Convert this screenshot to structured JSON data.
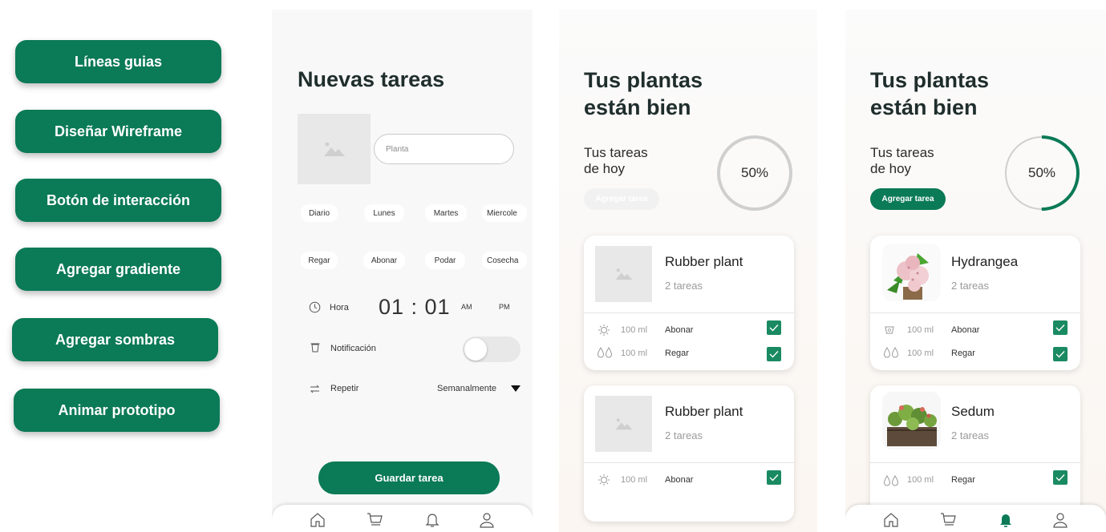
{
  "steps": [
    "Líneas guias",
    "Diseñar Wireframe",
    "Botón de interacción",
    "Agregar gradiente",
    "Agregar sombras",
    "Animar prototipo"
  ],
  "screen1": {
    "title": "Nuevas tareas",
    "plant_placeholder": "Planta",
    "days": [
      "Diario",
      "Lunes",
      "Martes",
      "Miercole"
    ],
    "tasks": [
      "Regar",
      "Abonar",
      "Podar",
      "Cosecha"
    ],
    "hour_label": "Hora",
    "time": "01 : 01",
    "am": "AM",
    "pm": "PM",
    "notification_label": "Notificación",
    "repeat_label": "Repetir",
    "repeat_value": "Semanalmente",
    "save_button": "Guardar tarea"
  },
  "screen2": {
    "title_line1": "Tus plantas",
    "title_line2": "están bien",
    "tasks_line1": "Tus tareas",
    "tasks_line2": "de hoy",
    "progress_text": "50%",
    "progress": 0.5,
    "add_task": "Agregar tarea",
    "cards": [
      {
        "name": "Rubber plant",
        "sub": "2 tareas",
        "rows": [
          {
            "icon": "sun-icon",
            "amount": "100 ml",
            "task": "Abonar"
          },
          {
            "icon": "water-drops-icon",
            "amount": "100 ml",
            "task": "Regar"
          }
        ]
      },
      {
        "name": "Rubber plant",
        "sub": "2 tareas",
        "rows": [
          {
            "icon": "sun-icon",
            "amount": "100 ml",
            "task": "Abonar"
          }
        ]
      }
    ]
  },
  "screen3": {
    "title_line1": "Tus plantas",
    "title_line2": "están bien",
    "tasks_line1": "Tus tareas",
    "tasks_line2": "de hoy",
    "progress_text": "50%",
    "progress": 0.5,
    "add_task": "Agregar tarea",
    "cards": [
      {
        "name": "Hydrangea",
        "sub": "2 tareas",
        "rows": [
          {
            "icon": "fertilizer-icon",
            "amount": "100 ml",
            "task": "Abonar"
          },
          {
            "icon": "water-drops-icon",
            "amount": "100 ml",
            "task": "Regar"
          }
        ]
      },
      {
        "name": "Sedum",
        "sub": "2 tareas",
        "rows": [
          {
            "icon": "water-drops-icon",
            "amount": "100 ml",
            "task": "Regar"
          }
        ]
      }
    ]
  },
  "colors": {
    "primary": "#0b7a56",
    "check": "#1a8a62",
    "ring_track": "#cfcfcf"
  }
}
